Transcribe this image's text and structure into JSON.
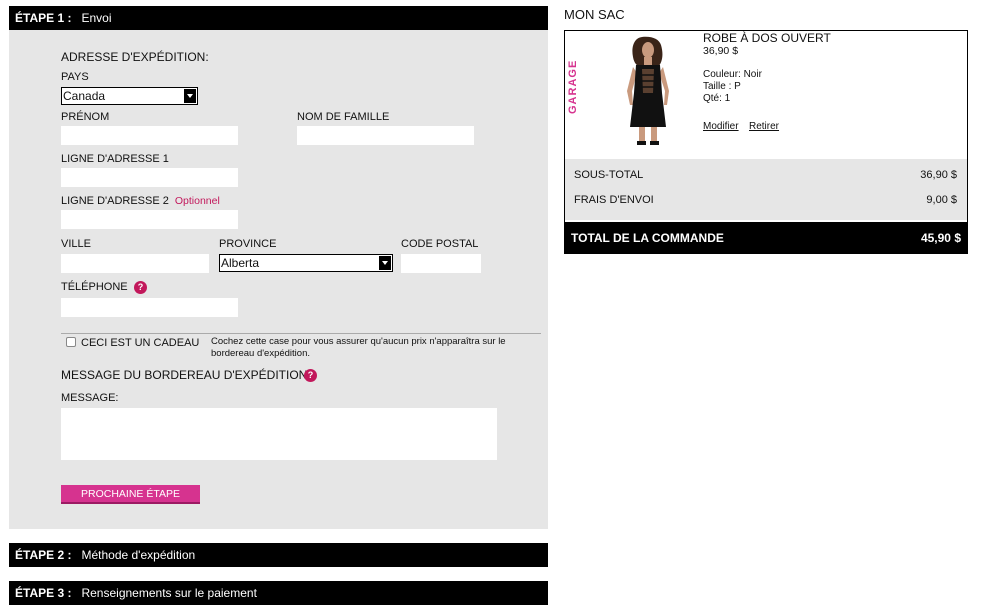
{
  "step1": {
    "number": "ÉTAPE 1 :",
    "title": "Envoi"
  },
  "step2": {
    "number": "ÉTAPE 2 :",
    "title": "Méthode d'expédition"
  },
  "step3": {
    "number": "ÉTAPE 3 :",
    "title": "Renseignements sur le paiement"
  },
  "form": {
    "heading": "ADRESSE D'EXPÉDITION:",
    "country_label": "PAYS",
    "country_value": "Canada",
    "first_name_label": "PRÉNOM",
    "last_name_label": "NOM DE FAMILLE",
    "address1_label": "LIGNE D'ADRESSE 1",
    "address2_label": "LIGNE D'ADRESSE 2",
    "address2_optional": "Optionnel",
    "city_label": "VILLE",
    "province_label": "PROVINCE",
    "province_value": "Alberta",
    "postal_label": "CODE POSTAL",
    "phone_label": "TÉLÉPHONE",
    "help_glyph": "?",
    "gift_label": "CECI EST UN CADEAU",
    "gift_note": "Cochez cette case pour vous assurer qu'aucun prix n'apparaîtra sur le bordereau d'expédition.",
    "packing_heading": "MESSAGE DU BORDEREAU D'EXPÉDITION",
    "message_label": "MESSAGE:",
    "next_button": "PROCHAINE ÉTAPE"
  },
  "bag": {
    "title": "MON SAC",
    "brand": "GARAGE",
    "product_name": "ROBE À DOS OUVERT",
    "price": "36,90 $",
    "color": "Couleur: Noir",
    "size": "Taille : P",
    "qty": "Qté: 1",
    "modify": "Modifier",
    "remove": "Retirer",
    "subtotal_label": "SOUS-TOTAL",
    "subtotal_value": "36,90 $",
    "shipping_label": "FRAIS D'ENVOI",
    "shipping_value": "9,00 $",
    "total_label": "TOTAL DE LA COMMANDE",
    "total_value": "45,90 $"
  },
  "colors": {
    "accent": "#d6338f",
    "bar": "#000000",
    "panel": "#e6e6e6"
  }
}
